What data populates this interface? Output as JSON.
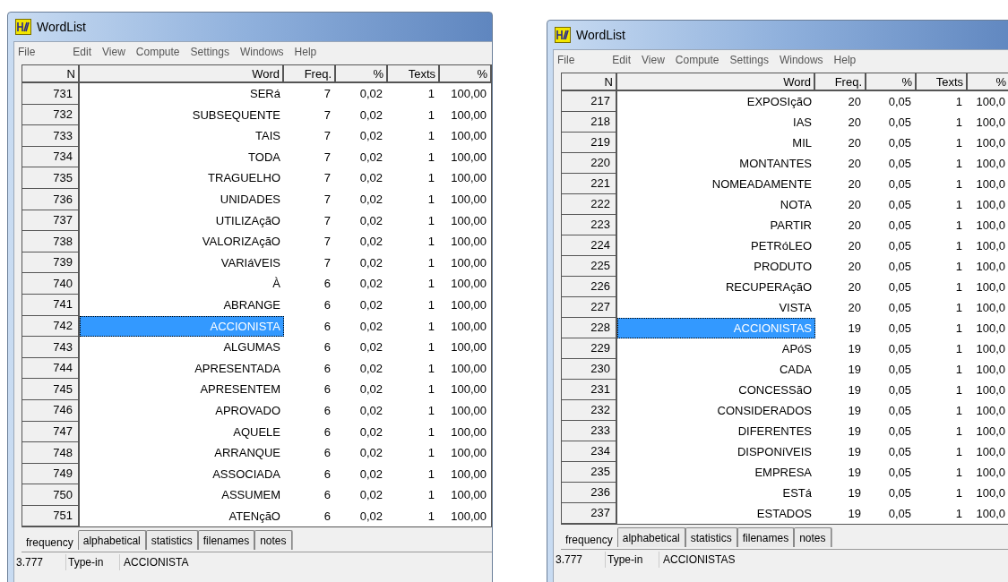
{
  "windows": [
    {
      "title": "WordList",
      "menu": [
        "File",
        "Edit",
        "View",
        "Compute",
        "Settings",
        "Windows",
        "Help"
      ],
      "columns": [
        "N",
        "Word",
        "Freq.",
        "%",
        "Texts",
        "%"
      ],
      "rows": [
        {
          "n": "731",
          "word": "SERá",
          "freq": "7",
          "pct": "0,02",
          "texts": "1",
          "texts_pct": "100,00",
          "selected": false
        },
        {
          "n": "732",
          "word": "SUBSEQUENTE",
          "freq": "7",
          "pct": "0,02",
          "texts": "1",
          "texts_pct": "100,00",
          "selected": false
        },
        {
          "n": "733",
          "word": "TAIS",
          "freq": "7",
          "pct": "0,02",
          "texts": "1",
          "texts_pct": "100,00",
          "selected": false
        },
        {
          "n": "734",
          "word": "TODA",
          "freq": "7",
          "pct": "0,02",
          "texts": "1",
          "texts_pct": "100,00",
          "selected": false
        },
        {
          "n": "735",
          "word": "TRAGUELHO",
          "freq": "7",
          "pct": "0,02",
          "texts": "1",
          "texts_pct": "100,00",
          "selected": false
        },
        {
          "n": "736",
          "word": "UNIDADES",
          "freq": "7",
          "pct": "0,02",
          "texts": "1",
          "texts_pct": "100,00",
          "selected": false
        },
        {
          "n": "737",
          "word": "UTILIZAçãO",
          "freq": "7",
          "pct": "0,02",
          "texts": "1",
          "texts_pct": "100,00",
          "selected": false
        },
        {
          "n": "738",
          "word": "VALORIZAçãO",
          "freq": "7",
          "pct": "0,02",
          "texts": "1",
          "texts_pct": "100,00",
          "selected": false
        },
        {
          "n": "739",
          "word": "VARIáVEIS",
          "freq": "7",
          "pct": "0,02",
          "texts": "1",
          "texts_pct": "100,00",
          "selected": false
        },
        {
          "n": "740",
          "word": "À",
          "freq": "6",
          "pct": "0,02",
          "texts": "1",
          "texts_pct": "100,00",
          "selected": false
        },
        {
          "n": "741",
          "word": "ABRANGE",
          "freq": "6",
          "pct": "0,02",
          "texts": "1",
          "texts_pct": "100,00",
          "selected": false
        },
        {
          "n": "742",
          "word": "ACCIONISTA",
          "freq": "6",
          "pct": "0,02",
          "texts": "1",
          "texts_pct": "100,00",
          "selected": true
        },
        {
          "n": "743",
          "word": "ALGUMAS",
          "freq": "6",
          "pct": "0,02",
          "texts": "1",
          "texts_pct": "100,00",
          "selected": false
        },
        {
          "n": "744",
          "word": "APRESENTADA",
          "freq": "6",
          "pct": "0,02",
          "texts": "1",
          "texts_pct": "100,00",
          "selected": false
        },
        {
          "n": "745",
          "word": "APRESENTEM",
          "freq": "6",
          "pct": "0,02",
          "texts": "1",
          "texts_pct": "100,00",
          "selected": false
        },
        {
          "n": "746",
          "word": "APROVADO",
          "freq": "6",
          "pct": "0,02",
          "texts": "1",
          "texts_pct": "100,00",
          "selected": false
        },
        {
          "n": "747",
          "word": "AQUELE",
          "freq": "6",
          "pct": "0,02",
          "texts": "1",
          "texts_pct": "100,00",
          "selected": false
        },
        {
          "n": "748",
          "word": "ARRANQUE",
          "freq": "6",
          "pct": "0,02",
          "texts": "1",
          "texts_pct": "100,00",
          "selected": false
        },
        {
          "n": "749",
          "word": "ASSOCIADA",
          "freq": "6",
          "pct": "0,02",
          "texts": "1",
          "texts_pct": "100,00",
          "selected": false
        },
        {
          "n": "750",
          "word": "ASSUMEM",
          "freq": "6",
          "pct": "0,02",
          "texts": "1",
          "texts_pct": "100,00",
          "selected": false
        },
        {
          "n": "751",
          "word": "ATENçãO",
          "freq": "6",
          "pct": "0,02",
          "texts": "1",
          "texts_pct": "100,00",
          "selected": false
        }
      ],
      "tabs": [
        {
          "label": "frequency",
          "selected": true
        },
        {
          "label": "alphabetical",
          "selected": false
        },
        {
          "label": "statistics",
          "selected": false
        },
        {
          "label": "filenames",
          "selected": false
        },
        {
          "label": "notes",
          "selected": false
        }
      ],
      "status_bar": [
        "3.777",
        "Type-in",
        "ACCIONISTA"
      ]
    },
    {
      "title": "WordList",
      "menu": [
        "File",
        "Edit",
        "View",
        "Compute",
        "Settings",
        "Windows",
        "Help"
      ],
      "columns": [
        "N",
        "Word",
        "Freq.",
        "%",
        "Texts",
        "%"
      ],
      "rows": [
        {
          "n": "217",
          "word": "EXPOSIçãO",
          "freq": "20",
          "pct": "0,05",
          "texts": "1",
          "texts_pct": "100,0",
          "selected": false
        },
        {
          "n": "218",
          "word": "IAS",
          "freq": "20",
          "pct": "0,05",
          "texts": "1",
          "texts_pct": "100,0",
          "selected": false
        },
        {
          "n": "219",
          "word": "MIL",
          "freq": "20",
          "pct": "0,05",
          "texts": "1",
          "texts_pct": "100,0",
          "selected": false
        },
        {
          "n": "220",
          "word": "MONTANTES",
          "freq": "20",
          "pct": "0,05",
          "texts": "1",
          "texts_pct": "100,0",
          "selected": false
        },
        {
          "n": "221",
          "word": "NOMEADAMENTE",
          "freq": "20",
          "pct": "0,05",
          "texts": "1",
          "texts_pct": "100,0",
          "selected": false
        },
        {
          "n": "222",
          "word": "NOTA",
          "freq": "20",
          "pct": "0,05",
          "texts": "1",
          "texts_pct": "100,0",
          "selected": false
        },
        {
          "n": "223",
          "word": "PARTIR",
          "freq": "20",
          "pct": "0,05",
          "texts": "1",
          "texts_pct": "100,0",
          "selected": false
        },
        {
          "n": "224",
          "word": "PETRóLEO",
          "freq": "20",
          "pct": "0,05",
          "texts": "1",
          "texts_pct": "100,0",
          "selected": false
        },
        {
          "n": "225",
          "word": "PRODUTO",
          "freq": "20",
          "pct": "0,05",
          "texts": "1",
          "texts_pct": "100,0",
          "selected": false
        },
        {
          "n": "226",
          "word": "RECUPERAçãO",
          "freq": "20",
          "pct": "0,05",
          "texts": "1",
          "texts_pct": "100,0",
          "selected": false
        },
        {
          "n": "227",
          "word": "VISTA",
          "freq": "20",
          "pct": "0,05",
          "texts": "1",
          "texts_pct": "100,0",
          "selected": false
        },
        {
          "n": "228",
          "word": "ACCIONISTAS",
          "freq": "19",
          "pct": "0,05",
          "texts": "1",
          "texts_pct": "100,0",
          "selected": true
        },
        {
          "n": "229",
          "word": "APóS",
          "freq": "19",
          "pct": "0,05",
          "texts": "1",
          "texts_pct": "100,0",
          "selected": false
        },
        {
          "n": "230",
          "word": "CADA",
          "freq": "19",
          "pct": "0,05",
          "texts": "1",
          "texts_pct": "100,0",
          "selected": false
        },
        {
          "n": "231",
          "word": "CONCESSãO",
          "freq": "19",
          "pct": "0,05",
          "texts": "1",
          "texts_pct": "100,0",
          "selected": false
        },
        {
          "n": "232",
          "word": "CONSIDERADOS",
          "freq": "19",
          "pct": "0,05",
          "texts": "1",
          "texts_pct": "100,0",
          "selected": false
        },
        {
          "n": "233",
          "word": "DIFERENTES",
          "freq": "19",
          "pct": "0,05",
          "texts": "1",
          "texts_pct": "100,0",
          "selected": false
        },
        {
          "n": "234",
          "word": "DISPONíVEIS",
          "freq": "19",
          "pct": "0,05",
          "texts": "1",
          "texts_pct": "100,0",
          "selected": false
        },
        {
          "n": "235",
          "word": "EMPRESA",
          "freq": "19",
          "pct": "0,05",
          "texts": "1",
          "texts_pct": "100,0",
          "selected": false
        },
        {
          "n": "236",
          "word": "ESTá",
          "freq": "19",
          "pct": "0,05",
          "texts": "1",
          "texts_pct": "100,0",
          "selected": false
        },
        {
          "n": "237",
          "word": "ESTADOS",
          "freq": "19",
          "pct": "0,05",
          "texts": "1",
          "texts_pct": "100,0",
          "selected": false
        }
      ],
      "tabs": [
        {
          "label": "frequency",
          "selected": true
        },
        {
          "label": "alphabetical",
          "selected": false
        },
        {
          "label": "statistics",
          "selected": false
        },
        {
          "label": "filenames",
          "selected": false
        },
        {
          "label": "notes",
          "selected": false
        }
      ],
      "status_bar": [
        "3.777",
        "Type-in",
        "ACCIONISTAS"
      ]
    }
  ]
}
